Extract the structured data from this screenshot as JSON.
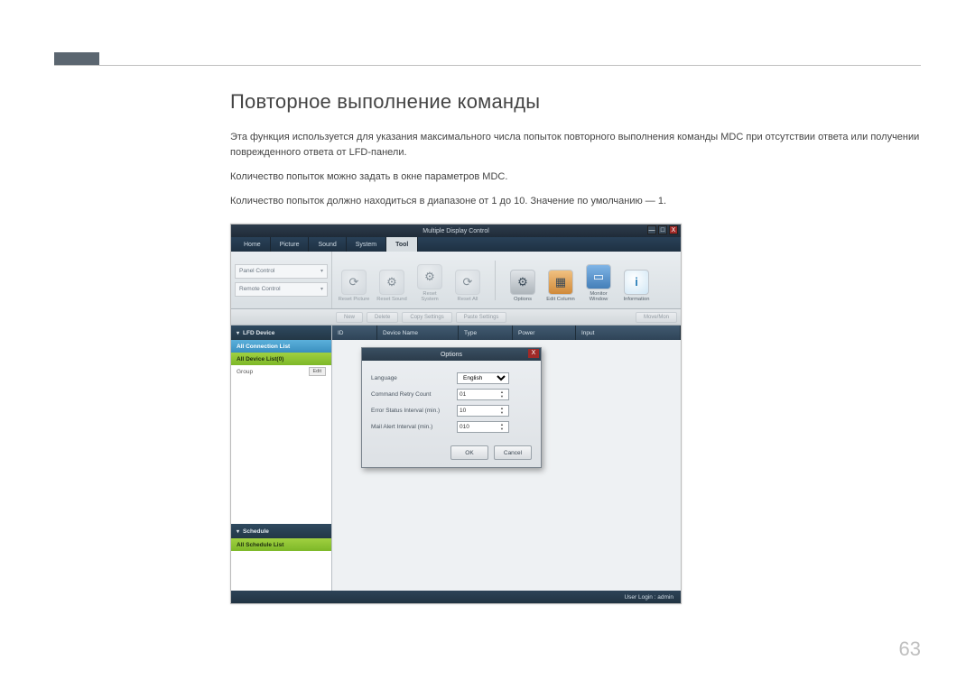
{
  "doc": {
    "heading": "Повторное выполнение команды",
    "p1": "Эта функция используется для указания максимального числа попыток повторного выполнения команды MDC при отсутствии ответа или получении поврежденного ответа от LFD-панели.",
    "p2": "Количество попыток можно задать в окне параметров MDC.",
    "p3": "Количество попыток должно находиться в диапазоне от 1 до 10. Значение по умолчанию — 1.",
    "page_number": "63"
  },
  "app": {
    "title": "Multiple Display Control",
    "window": {
      "min": "—",
      "max": "□",
      "close": "X"
    },
    "menu": [
      "Home",
      "Picture",
      "Sound",
      "System",
      "Tool"
    ],
    "filters": [
      "Panel Control",
      "Remote Control"
    ],
    "toolbar": {
      "reset_group": [
        {
          "label": "Reset Picture"
        },
        {
          "label": "Reset Sound"
        },
        {
          "label": "Reset System"
        },
        {
          "label": "Reset All"
        }
      ],
      "main_group": [
        {
          "label": "Options",
          "icon": "⚙"
        },
        {
          "label": "Edit Column",
          "icon": "▦"
        },
        {
          "label": "Monitor Window",
          "icon": "▭"
        },
        {
          "label": "Information",
          "icon": "i"
        }
      ]
    },
    "action_buttons": {
      "new": "New",
      "delete": "Delete",
      "copy": "Copy Settings",
      "paste": "Paste Settings",
      "move": "Move/Mon"
    },
    "sidebar": {
      "lfd_head": "LFD Device",
      "all_conn": "All Connection List",
      "all_dev": "All Device List(0)",
      "group": "Group",
      "edit": "Edit",
      "sched_head": "Schedule",
      "all_sched": "All Schedule List"
    },
    "columns": [
      "ID",
      "Device Name",
      "Type",
      "Power",
      "Input"
    ],
    "status": "User Login : admin"
  },
  "dialog": {
    "title": "Options",
    "close": "X",
    "rows": {
      "language": {
        "label": "Language",
        "value": "English"
      },
      "retry": {
        "label": "Command Retry Count",
        "value": "01"
      },
      "error": {
        "label": "Error Status Interval (min.)",
        "value": "10"
      },
      "mail": {
        "label": "Mail Alert Interval (min.)",
        "value": "010"
      }
    },
    "ok": "OK",
    "cancel": "Cancel"
  }
}
